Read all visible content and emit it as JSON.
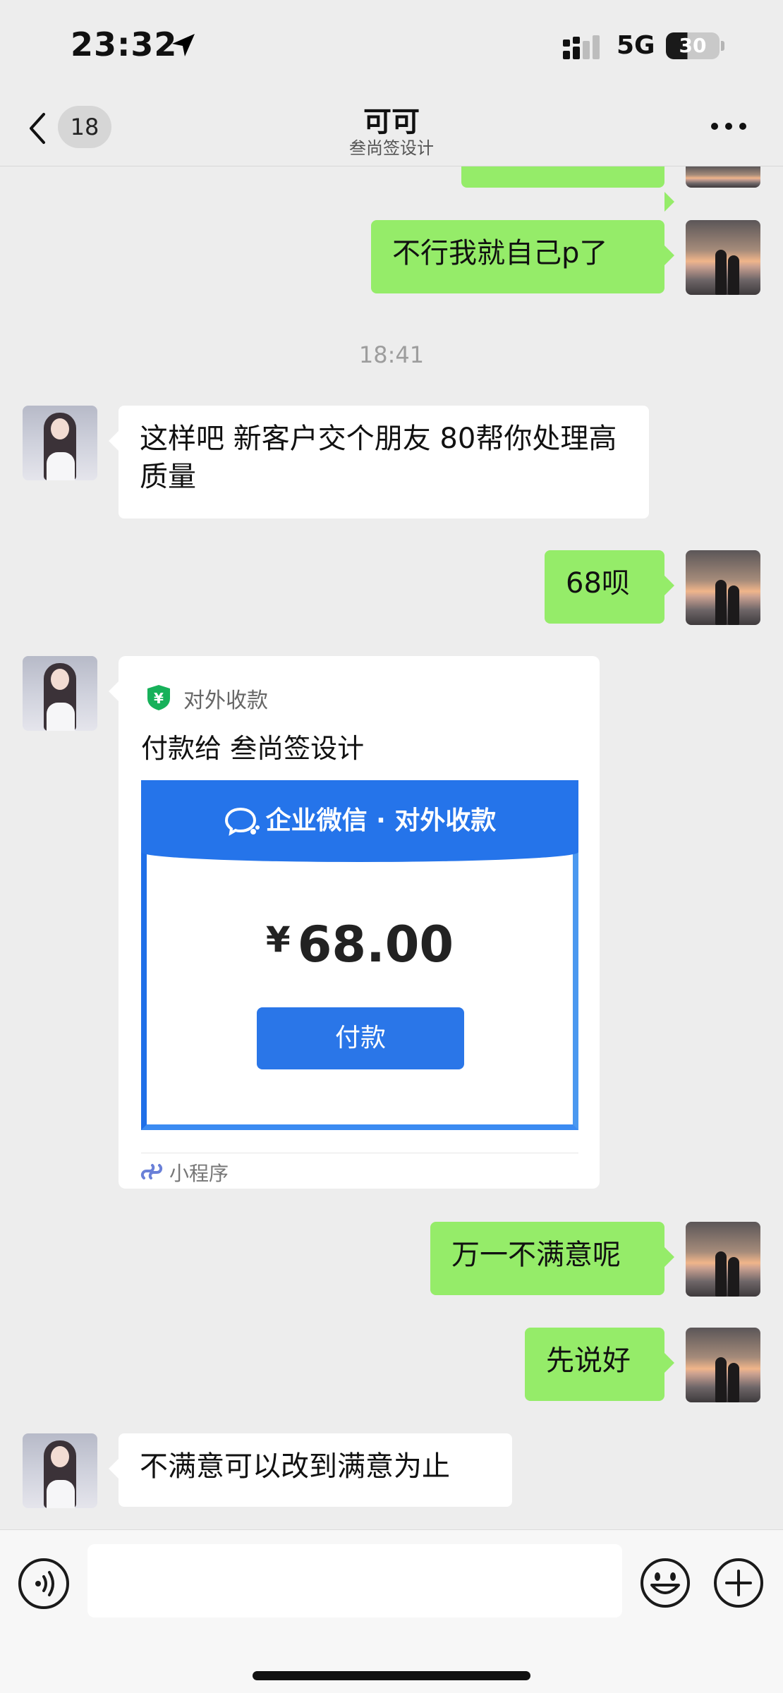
{
  "status_bar": {
    "time": "23:32",
    "network": "5G",
    "battery": "30"
  },
  "nav": {
    "unread_count": "18",
    "title": "可可",
    "subtitle": "叁尚签设计"
  },
  "time_stamp": "18:41",
  "messages": [
    {
      "side": "out",
      "text": "不行我就自己p了"
    },
    {
      "side": "in",
      "text": "这样吧  新客户交个朋友  80帮你处理高质量"
    },
    {
      "side": "out",
      "text": "68呗"
    },
    {
      "side": "out",
      "text": "万一不满意呢"
    },
    {
      "side": "out",
      "text": "先说好"
    },
    {
      "side": "in",
      "text": "不满意可以改到满意为止"
    }
  ],
  "payment_card": {
    "app_name": "对外收款",
    "title": "付款给 叁尚签设计",
    "banner": "企业微信 · 对外收款",
    "currency": "¥",
    "amount": "68.00",
    "pay_button": "付款",
    "footer": "小程序"
  },
  "colors": {
    "outgoing_bubble": "#95ec69",
    "incoming_bubble": "#ffffff",
    "background": "#ededed",
    "brand_blue": "#2574ea"
  },
  "icons": [
    "location-arrow-icon",
    "signal-icon",
    "battery-icon",
    "back-chevron-icon",
    "more-dots-icon",
    "yuan-shield-icon",
    "wecom-chat-icon",
    "mini-program-link-icon",
    "voice-icon",
    "emoji-icon",
    "plus-icon"
  ]
}
